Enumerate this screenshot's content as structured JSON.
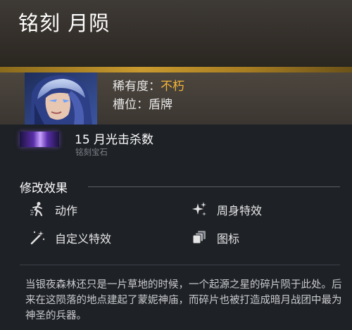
{
  "header": {
    "title": "铭刻 月陨"
  },
  "meta": {
    "rarity_label": "稀有度：",
    "rarity_value": "不朽",
    "slot_label": "槽位：",
    "slot_value": "盾牌",
    "rarity_color": "#f2b33a"
  },
  "gem": {
    "name": "15 月光击杀数",
    "subtitle": "铭刻宝石",
    "swatch_color": "#8a5ee0"
  },
  "effects": {
    "title": "修改效果",
    "items": [
      {
        "label": "动作",
        "icon": "running-figure-icon"
      },
      {
        "label": "周身特效",
        "icon": "sparkles-icon"
      },
      {
        "label": "自定义特效",
        "icon": "magic-wand-icon"
      },
      {
        "label": "图标",
        "icon": "stacked-cards-icon"
      }
    ]
  },
  "description": "当银夜森林还只是一片草地的时候，一个起源之星的碎片陨于此处。后来在这陨落的地点建起了蒙妮神庙，而碎片也被打造成暗月战团中最为神圣的兵器。"
}
